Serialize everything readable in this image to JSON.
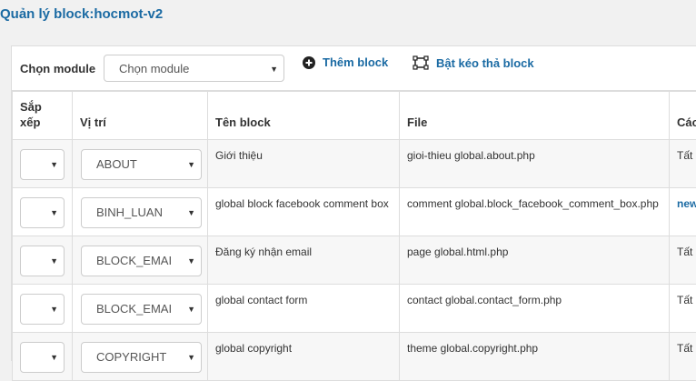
{
  "page": {
    "title": "Quản lý block:hocmot-v2"
  },
  "toolbar": {
    "module_label": "Chọn module",
    "module_select_value": "Chọn module",
    "add_block_label": "Thêm block",
    "drag_mode_label": "Bật kéo thả block",
    "icons": {
      "add": "plus-circle-icon",
      "drag": "drag-frame-icon"
    }
  },
  "table": {
    "headers": {
      "sort": "Sắp\nxếp",
      "position": "Vị trí",
      "name": "Tên block",
      "file": "File",
      "action": "Các"
    },
    "rows": [
      {
        "sort": "",
        "position": "ABOUT",
        "name": "Giới thiệu",
        "file": "gioi-thieu global.about.php",
        "action": "Tất"
      },
      {
        "sort": "",
        "position": "BINH_LUAN",
        "name": "global block facebook comment box",
        "file": "comment global.block_facebook_comment_box.php",
        "action": "new"
      },
      {
        "sort": "",
        "position": "BLOCK_EMAI",
        "name": "Đăng ký nhận email",
        "file": "page global.html.php",
        "action": "Tất"
      },
      {
        "sort": "",
        "position": "BLOCK_EMAI",
        "name": "global contact form",
        "file": "contact global.contact_form.php",
        "action": "Tất"
      },
      {
        "sort": "",
        "position": "COPYRIGHT",
        "name": "global copyright",
        "file": "theme global.copyright.php",
        "action": "Tất"
      }
    ]
  },
  "colors": {
    "accent": "#1a6aa3",
    "page_bg": "#f1f1f1",
    "stripe": "#f7f7f7",
    "border": "#dddddd"
  }
}
